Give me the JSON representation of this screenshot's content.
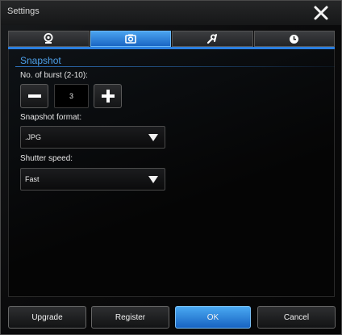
{
  "window": {
    "title": "Settings"
  },
  "tabs": [
    {
      "icon": "webcam-icon",
      "active": false
    },
    {
      "icon": "camera-icon",
      "active": true
    },
    {
      "icon": "tools-icon",
      "active": false
    },
    {
      "icon": "clock-icon",
      "active": false
    }
  ],
  "snapshot": {
    "section_title": "Snapshot",
    "burst_label": "No. of burst (2-10):",
    "burst_value": "3",
    "format_label": "Snapshot format:",
    "format_value": ".JPG",
    "shutter_label": "Shutter speed:",
    "shutter_value": "Fast"
  },
  "buttons": {
    "upgrade": "Upgrade",
    "register": "Register",
    "ok": "OK",
    "cancel": "Cancel"
  },
  "colors": {
    "accent": "#2b7fe0",
    "section_title": "#4d9fe8"
  }
}
